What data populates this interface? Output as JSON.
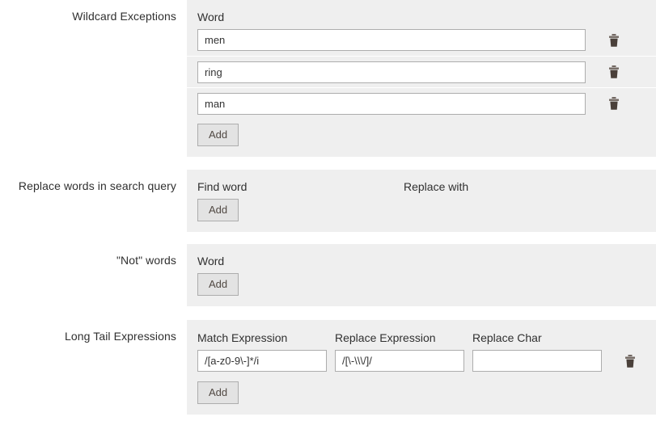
{
  "sections": [
    {
      "id": "wildcard",
      "label": "Wildcard Exceptions",
      "columns": [
        {
          "title": "Word"
        }
      ],
      "rows": [
        {
          "cells": [
            {
              "value": "men",
              "placeholder": ""
            }
          ],
          "delete_icon": "trash-icon"
        },
        {
          "cells": [
            {
              "value": "ring",
              "placeholder": ""
            }
          ],
          "delete_icon": "trash-icon"
        },
        {
          "cells": [
            {
              "value": "man",
              "placeholder": ""
            }
          ],
          "delete_icon": "trash-icon"
        }
      ],
      "add_label": "Add"
    },
    {
      "id": "replace",
      "label": "Replace words in search query",
      "columns": [
        {
          "title": "Find word"
        },
        {
          "title": "Replace with"
        }
      ],
      "rows": [],
      "add_label": "Add"
    },
    {
      "id": "not",
      "label": "\"Not\" words",
      "columns": [
        {
          "title": "Word"
        }
      ],
      "rows": [],
      "add_label": "Add"
    },
    {
      "id": "longtail",
      "label": "Long Tail Expressions",
      "columns": [
        {
          "title": "Match Expression"
        },
        {
          "title": "Replace Expression"
        },
        {
          "title": "Replace Char"
        }
      ],
      "rows": [
        {
          "cells": [
            {
              "value": "/[a-z0-9\\-]*/i",
              "placeholder": ""
            },
            {
              "value": "/[\\-\\\\\\/]/",
              "placeholder": ""
            },
            {
              "value": "",
              "placeholder": ""
            }
          ],
          "delete_icon": "trash-icon"
        }
      ],
      "add_label": "Add"
    }
  ],
  "colors": {
    "panel_background": "#efefef",
    "page_background": "#ffffff",
    "input_border": "#adadad",
    "button_background": "#e3e3e3",
    "button_text": "#514943",
    "label_text": "#303030",
    "trash_icon": "#736963"
  }
}
